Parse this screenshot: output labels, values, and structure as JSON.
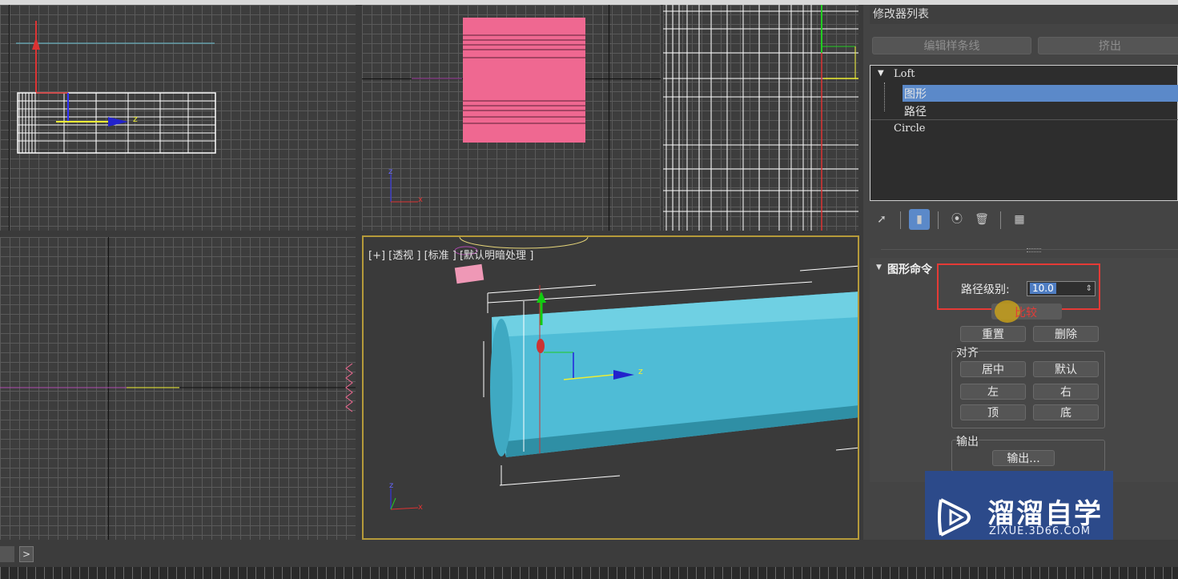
{
  "viewports": {
    "perspective_label": "[+] [透视 ] [标准 ] [默认明暗处理 ]",
    "axis_z": "z",
    "axis_x": "x"
  },
  "command_panel": {
    "modifier_list_label": "修改器列表",
    "buttons": {
      "edit_spline": "编辑样条线",
      "extrude": "挤出"
    },
    "stack": {
      "loft": "Loft",
      "shape": "图形",
      "path": "路径",
      "circle": "Circle",
      "expand_glyph": "▼"
    },
    "toolbar_icons": [
      "pin-stack-icon",
      "show-end-result-icon",
      "make-unique-icon",
      "remove-modifier-icon",
      "configure-modifier-sets-icon"
    ],
    "shape_commands": {
      "title": "图形命令",
      "path_level_label": "路径级别:",
      "path_level_value": "10.0",
      "compare": "比较",
      "reset": "重置",
      "delete": "删除",
      "align_group": "对齐",
      "center": "居中",
      "default": "默认",
      "left": "左",
      "right": "右",
      "top": "顶",
      "bottom": "底",
      "output_group": "输出",
      "output_button": "输出..."
    }
  },
  "watermark": {
    "brand": "溜溜自学",
    "url": "ZIXUE.3D66.COM"
  },
  "status": {
    "nav_arrow": ">"
  },
  "colors": {
    "accent_selected": "#5b89c9",
    "highlight_box": "#e53a36",
    "pink_object": "#ef6891",
    "cyan_object": "#4fbcd6"
  }
}
